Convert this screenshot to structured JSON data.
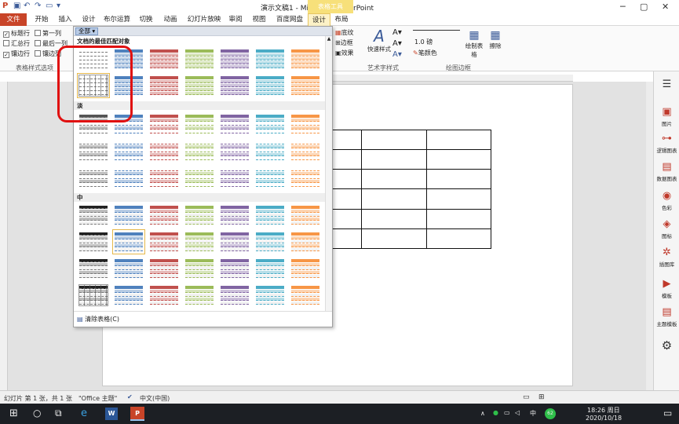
{
  "app": {
    "title": "演示文稿1 - Microsoft PowerPoint",
    "contextual_tab_header": "表格工具"
  },
  "tabs": [
    {
      "label": "文件"
    },
    {
      "label": "开始"
    },
    {
      "label": "插入"
    },
    {
      "label": "设计"
    },
    {
      "label": "布尔运算"
    },
    {
      "label": "切换"
    },
    {
      "label": "动画"
    },
    {
      "label": "幻灯片放映"
    },
    {
      "label": "审阅"
    },
    {
      "label": "视图"
    },
    {
      "label": "百度网盘"
    },
    {
      "label": "设计"
    },
    {
      "label": "布局"
    }
  ],
  "ribbon": {
    "options": {
      "header_row": "标题行",
      "first_column": "第一列",
      "total_row": "汇总行",
      "last_column": "最后一列",
      "banded_rows": "镶边行",
      "banded_columns": "镶边列",
      "group_label": "表格样式选项"
    },
    "shading": "底纹",
    "borders": "边框",
    "effects": "效果",
    "quick_styles": "快速样式",
    "wordart_group": "艺术字样式",
    "pen_weight": "1.0 磅",
    "pen_color": "笔颜色",
    "draw_table": "绘制表格",
    "eraser": "擦除",
    "draw_borders_group": "绘图边框"
  },
  "gallery": {
    "filter": "全部",
    "section_best": "文档的最佳匹配对象",
    "section_light": "淡",
    "section_medium": "中",
    "clear_table": "清除表格(C)"
  },
  "right_pane": [
    {
      "label": "图片"
    },
    {
      "label": "逻辑图表"
    },
    {
      "label": "数据图表"
    },
    {
      "label": "色彩"
    },
    {
      "label": "图标"
    },
    {
      "label": "插图库"
    },
    {
      "label": "模板"
    },
    {
      "label": "主题模板"
    }
  ],
  "statusbar": {
    "slide_info": "幻灯片 第 1 张，共 1 张",
    "theme": "\"Office 主题\"",
    "language": "中文(中国)"
  },
  "taskbar": {
    "time": "18:26 周日",
    "date": "2020/10/18",
    "ime": "中",
    "badge": "62"
  },
  "colors": {
    "file_tab": "#c84428",
    "contextual_header": "#f7e07a",
    "highlight": "#e01010"
  }
}
